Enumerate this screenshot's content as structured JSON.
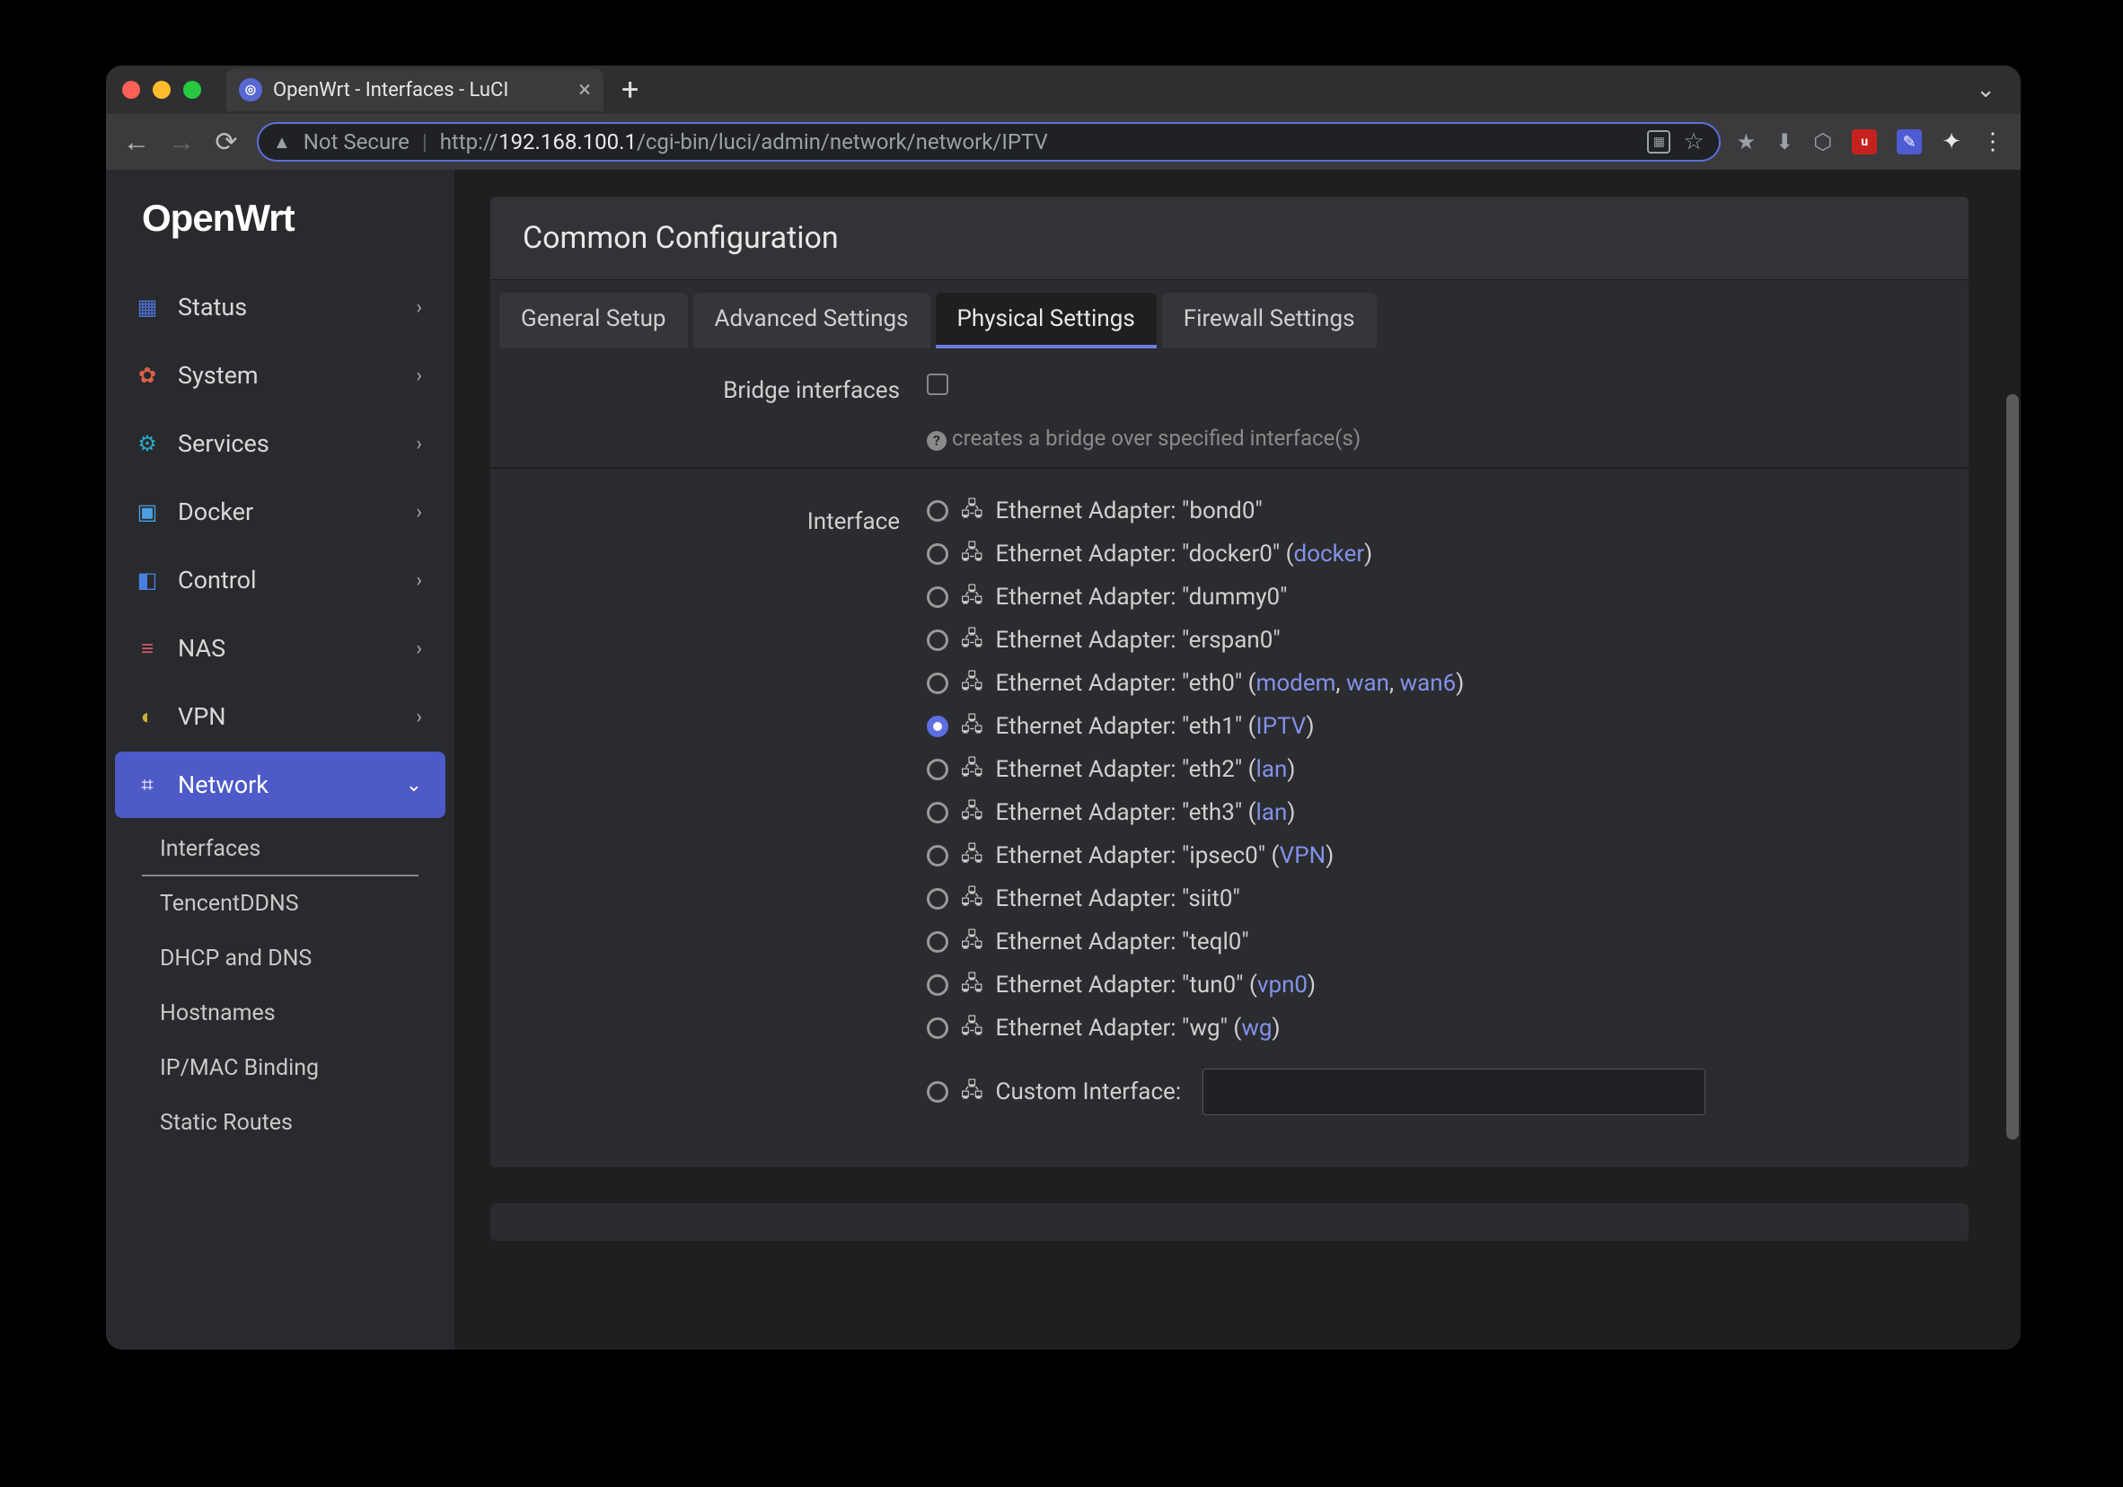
{
  "browser": {
    "tab_title": "OpenWrt - Interfaces - LuCI",
    "url_insecure_label": "Not Secure",
    "url_scheme": "http://",
    "url_host": "192.168.100.1",
    "url_path": "/cgi-bin/luci/admin/network/network/IPTV"
  },
  "sidebar": {
    "logo": "OpenWrt",
    "items": [
      {
        "label": "Status",
        "icon_color": "ic-status",
        "glyph": "▦"
      },
      {
        "label": "System",
        "icon_color": "ic-system",
        "glyph": "✿"
      },
      {
        "label": "Services",
        "icon_color": "ic-services",
        "glyph": "⚙"
      },
      {
        "label": "Docker",
        "icon_color": "ic-docker",
        "glyph": "▣"
      },
      {
        "label": "Control",
        "icon_color": "ic-control",
        "glyph": "◧"
      },
      {
        "label": "NAS",
        "icon_color": "ic-nas",
        "glyph": "≡"
      },
      {
        "label": "VPN",
        "icon_color": "ic-vpn",
        "glyph": "◐"
      },
      {
        "label": "Network",
        "icon_color": "ic-network",
        "glyph": "⌗",
        "active": true
      }
    ],
    "submenu": [
      {
        "label": "Interfaces",
        "current": true
      },
      {
        "label": "TencentDDNS"
      },
      {
        "label": "DHCP and DNS"
      },
      {
        "label": "Hostnames"
      },
      {
        "label": "IP/MAC Binding"
      },
      {
        "label": "Static Routes"
      }
    ]
  },
  "panel": {
    "title": "Common Configuration",
    "tabs": [
      {
        "label": "General Setup"
      },
      {
        "label": "Advanced Settings"
      },
      {
        "label": "Physical Settings",
        "active": true
      },
      {
        "label": "Firewall Settings"
      }
    ],
    "bridge": {
      "label": "Bridge interfaces",
      "hint": "creates a bridge over specified interface(s)"
    },
    "interface_label": "Interface",
    "interfaces": [
      {
        "name": "bond0",
        "tags": [],
        "checked": false
      },
      {
        "name": "docker0",
        "tags": [
          "docker"
        ],
        "checked": false
      },
      {
        "name": "dummy0",
        "tags": [],
        "checked": false
      },
      {
        "name": "erspan0",
        "tags": [],
        "checked": false
      },
      {
        "name": "eth0",
        "tags": [
          "modem",
          "wan",
          "wan6"
        ],
        "checked": false
      },
      {
        "name": "eth1",
        "tags": [
          "IPTV"
        ],
        "checked": true
      },
      {
        "name": "eth2",
        "tags": [
          "lan"
        ],
        "checked": false
      },
      {
        "name": "eth3",
        "tags": [
          "lan"
        ],
        "checked": false
      },
      {
        "name": "ipsec0",
        "tags": [
          "VPN"
        ],
        "checked": false
      },
      {
        "name": "siit0",
        "tags": [],
        "checked": false
      },
      {
        "name": "teql0",
        "tags": [],
        "checked": false
      },
      {
        "name": "tun0",
        "tags": [
          "vpn0"
        ],
        "checked": false
      },
      {
        "name": "wg",
        "tags": [
          "wg"
        ],
        "checked": false
      }
    ],
    "adapter_prefix": "Ethernet Adapter: ",
    "custom_label": "Custom Interface:"
  }
}
